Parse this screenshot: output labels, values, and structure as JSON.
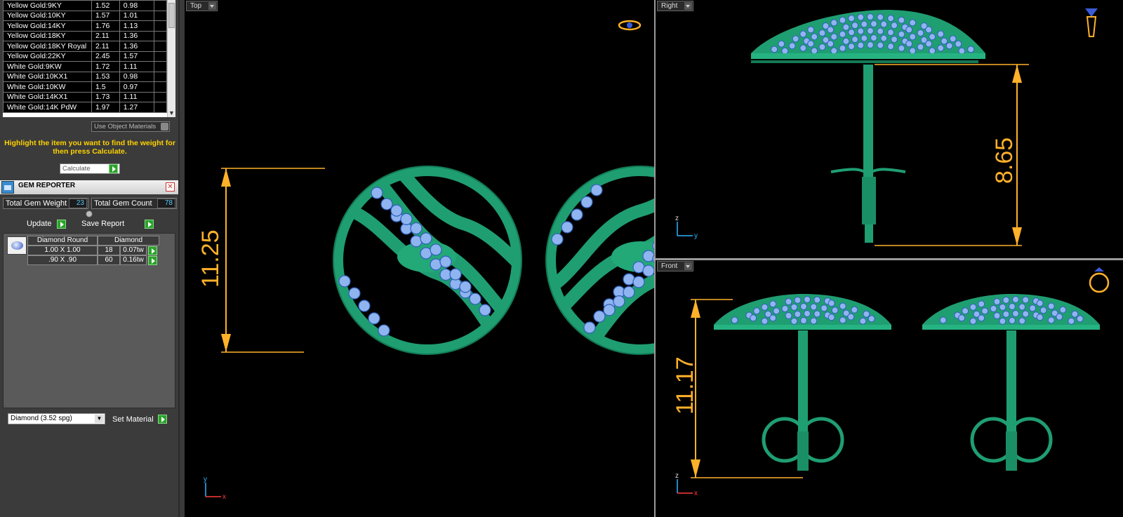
{
  "materials": {
    "rows": [
      {
        "name": "Yellow Gold:9KY",
        "a": "1.52",
        "b": "0.98"
      },
      {
        "name": "Yellow Gold:10KY",
        "a": "1.57",
        "b": "1.01"
      },
      {
        "name": "Yellow Gold:14KY",
        "a": "1.76",
        "b": "1.13"
      },
      {
        "name": "Yellow Gold:18KY",
        "a": "2.11",
        "b": "1.36"
      },
      {
        "name": "Yellow Gold:18KY Royal",
        "a": "2.11",
        "b": "1.36"
      },
      {
        "name": "Yellow Gold:22KY",
        "a": "2.45",
        "b": "1.57"
      },
      {
        "name": "White Gold:9KW",
        "a": "1.72",
        "b": "1.11"
      },
      {
        "name": "White Gold:10KX1",
        "a": "1.53",
        "b": "0.98"
      },
      {
        "name": "White Gold:10KW",
        "a": "1.5",
        "b": "0.97"
      },
      {
        "name": "White Gold:14KX1",
        "a": "1.73",
        "b": "1.11"
      },
      {
        "name": "White Gold:14K PdW",
        "a": "1.97",
        "b": "1.27"
      }
    ],
    "use_object_materials": "Use Object Materials",
    "hint": "Highlight the item you want to find the weight for then press Calculate.",
    "calculate": "Calculate"
  },
  "gem_reporter": {
    "title": "GEM REPORTER",
    "total_weight_label": "Total Gem Weight",
    "total_weight": "23",
    "total_count_label": "Total Gem Count",
    "total_count": "78",
    "update": "Update",
    "save_report": "Save Report",
    "gem_type": "Diamond Round",
    "gem_material": "Diamond",
    "rows": [
      {
        "size": "1.00 X 1.00",
        "count": "18",
        "weight": "0.07tw"
      },
      {
        "size": ".90 X .90",
        "count": "60",
        "weight": "0.16tw"
      }
    ],
    "material_select": "Diamond     (3.52 spg)",
    "set_material": "Set Material"
  },
  "viewports": {
    "top": {
      "label": "Top",
      "dimension": "11.25",
      "axis_a": "y",
      "axis_b": "x"
    },
    "right": {
      "label": "Right",
      "dimension": "8.65",
      "axis_a": "z",
      "axis_b": "y"
    },
    "front": {
      "label": "Front",
      "dimension": "11.17",
      "axis_a": "z",
      "axis_b": "x"
    }
  },
  "colors": {
    "metal": "#1f9e72",
    "gem": "#8fb4f0",
    "dimension": "#ffb12a"
  }
}
